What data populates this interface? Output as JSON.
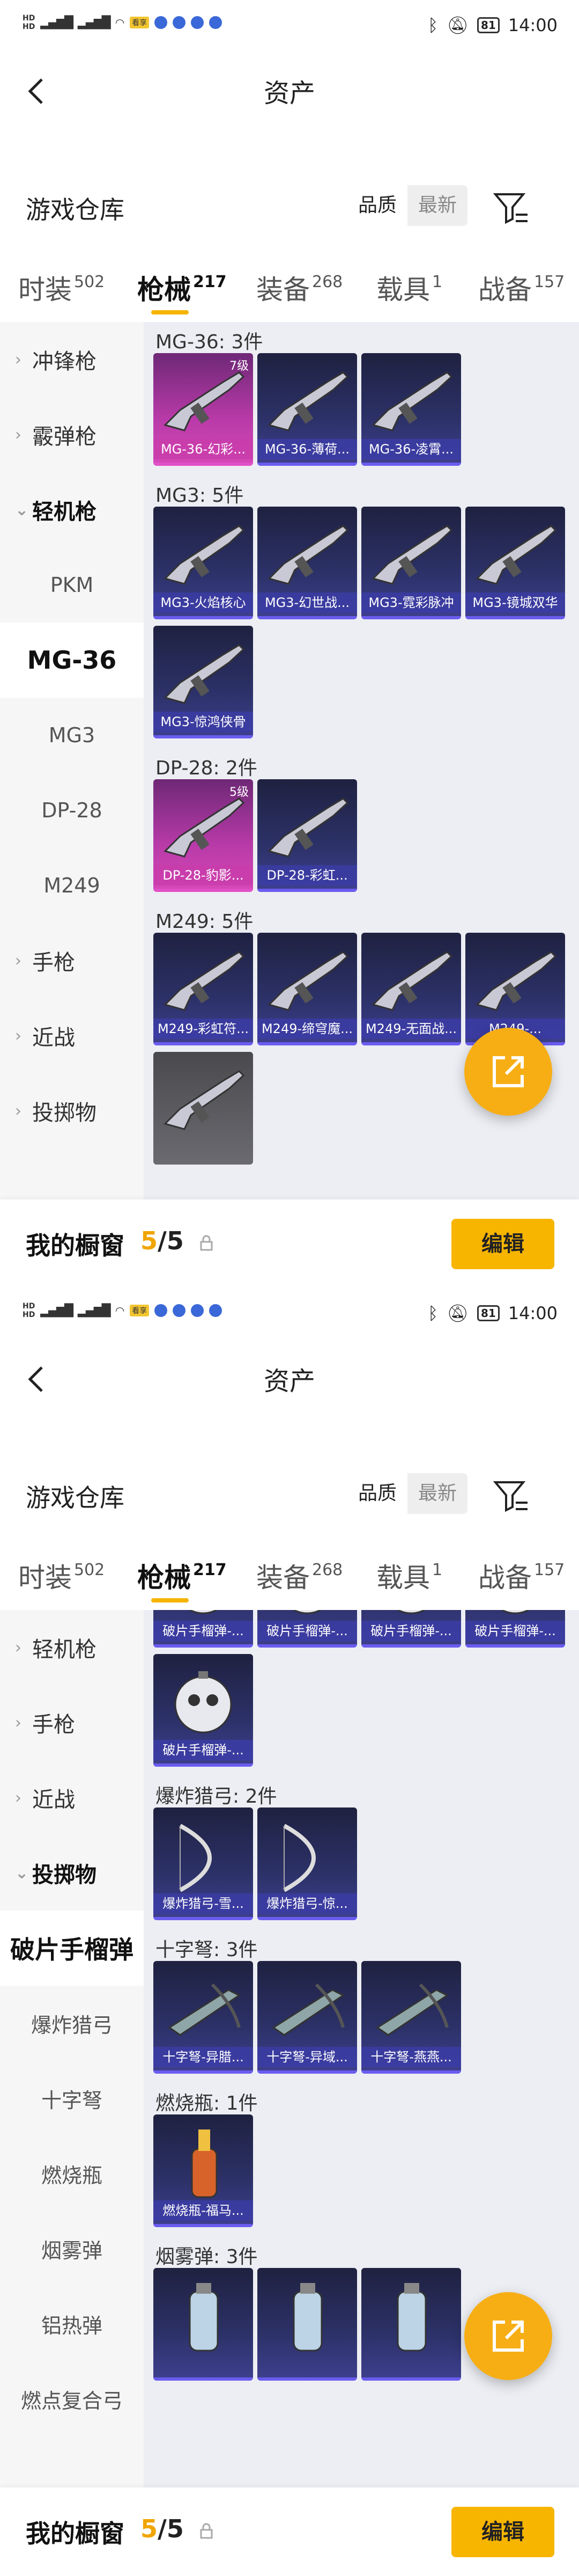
{
  "status": {
    "time": "14:00",
    "battery": "81",
    "badge": "看享"
  },
  "header": {
    "title": "资产"
  },
  "warehouse": {
    "title": "游戏仓库",
    "sort_quality": "品质",
    "sort_latest": "最新"
  },
  "tabs": [
    {
      "label": "时装",
      "count": "502"
    },
    {
      "label": "枪械",
      "count": "217"
    },
    {
      "label": "装备",
      "count": "268"
    },
    {
      "label": "载具",
      "count": "1"
    },
    {
      "label": "战备",
      "count": "157"
    }
  ],
  "bottom": {
    "title": "我的橱窗",
    "current": "5",
    "total": "/5",
    "edit_label": "编辑"
  },
  "colors": {
    "accent": "#f7b500",
    "card_blue": "#2c3168",
    "card_pink": "#b83aa8"
  },
  "screen1": {
    "sidebar": [
      {
        "label": "冲锋枪",
        "type": "parent"
      },
      {
        "label": "霰弹枪",
        "type": "parent"
      },
      {
        "label": "轻机枪",
        "type": "parent-open"
      },
      {
        "label": "PKM",
        "type": "child"
      },
      {
        "label": "MG-36",
        "type": "child-active"
      },
      {
        "label": "MG3",
        "type": "child"
      },
      {
        "label": "DP-28",
        "type": "child"
      },
      {
        "label": "M249",
        "type": "child"
      },
      {
        "label": "手枪",
        "type": "parent"
      },
      {
        "label": "近战",
        "type": "parent"
      },
      {
        "label": "投掷物",
        "type": "parent"
      }
    ],
    "groups": [
      {
        "title": "MG-36: 3件",
        "items": [
          {
            "name": "MG-36-幻彩...",
            "style": "pink",
            "level": "7级",
            "icon": "gun"
          },
          {
            "name": "MG-36-薄荷...",
            "style": "blue",
            "icon": "gun"
          },
          {
            "name": "MG-36-凌霄...",
            "style": "blue",
            "icon": "gun"
          }
        ]
      },
      {
        "title": "MG3: 5件",
        "items": [
          {
            "name": "MG3-火焰核心",
            "style": "blue",
            "icon": "gun"
          },
          {
            "name": "MG3-幻世战...",
            "style": "blue",
            "icon": "gun"
          },
          {
            "name": "MG3-霓彩脉冲",
            "style": "blue",
            "icon": "gun"
          },
          {
            "name": "MG3-镜城双华",
            "style": "blue",
            "icon": "gun"
          },
          {
            "name": "MG3-惊鸿侠骨",
            "style": "blue",
            "icon": "gun"
          }
        ]
      },
      {
        "title": "DP-28: 2件",
        "items": [
          {
            "name": "DP-28-豹影...",
            "style": "pink",
            "level": "5级",
            "icon": "gun"
          },
          {
            "name": "DP-28-彩虹...",
            "style": "blue",
            "icon": "gun"
          }
        ]
      },
      {
        "title": "M249: 5件",
        "items": [
          {
            "name": "M249-彩虹符...",
            "style": "blue",
            "icon": "gun"
          },
          {
            "name": "M249-缔穹魔...",
            "style": "blue",
            "icon": "gun"
          },
          {
            "name": "M249-无面战...",
            "style": "blue",
            "icon": "gun"
          },
          {
            "name": "M249-...",
            "style": "blue",
            "icon": "gun"
          },
          {
            "name": "",
            "style": "gray",
            "icon": "gun"
          }
        ]
      }
    ]
  },
  "screen2": {
    "sidebar": [
      {
        "label": "轻机枪",
        "type": "parent"
      },
      {
        "label": "手枪",
        "type": "parent"
      },
      {
        "label": "近战",
        "type": "parent"
      },
      {
        "label": "投掷物",
        "type": "parent-open"
      },
      {
        "label": "破片手榴弹",
        "type": "child-active"
      },
      {
        "label": "爆炸猎弓",
        "type": "child"
      },
      {
        "label": "十字弩",
        "type": "child"
      },
      {
        "label": "燃烧瓶",
        "type": "child"
      },
      {
        "label": "烟雾弹",
        "type": "child"
      },
      {
        "label": "铝热弹",
        "type": "child"
      },
      {
        "label": "燃点复合弓",
        "type": "child"
      }
    ],
    "groups": [
      {
        "title": "",
        "items": [
          {
            "name": "破片手榴弹-...",
            "style": "blue",
            "icon": "grenade"
          },
          {
            "name": "破片手榴弹-...",
            "style": "blue",
            "icon": "grenade"
          },
          {
            "name": "破片手榴弹-...",
            "style": "blue",
            "icon": "grenade"
          },
          {
            "name": "破片手榴弹-...",
            "style": "blue",
            "icon": "grenade"
          },
          {
            "name": "破片手榴弹-...",
            "style": "blue",
            "icon": "grenade"
          }
        ]
      },
      {
        "title": "爆炸猎弓: 2件",
        "items": [
          {
            "name": "爆炸猎弓-雪...",
            "style": "blue",
            "icon": "bow"
          },
          {
            "name": "爆炸猎弓-惊...",
            "style": "blue",
            "icon": "bow"
          }
        ]
      },
      {
        "title": "十字弩: 3件",
        "items": [
          {
            "name": "十字弩-异腊...",
            "style": "blue",
            "icon": "crossbow"
          },
          {
            "name": "十字弩-异域...",
            "style": "blue",
            "icon": "crossbow"
          },
          {
            "name": "十字弩-燕燕...",
            "style": "blue",
            "icon": "crossbow"
          }
        ]
      },
      {
        "title": "燃烧瓶: 1件",
        "items": [
          {
            "name": "燃烧瓶-福马...",
            "style": "blue",
            "icon": "molotov"
          }
        ]
      },
      {
        "title": "烟雾弹: 3件",
        "items": [
          {
            "name": "",
            "style": "blue",
            "icon": "smoke"
          },
          {
            "name": "",
            "style": "blue",
            "icon": "smoke"
          },
          {
            "name": "",
            "style": "blue",
            "icon": "smoke"
          }
        ]
      }
    ]
  }
}
